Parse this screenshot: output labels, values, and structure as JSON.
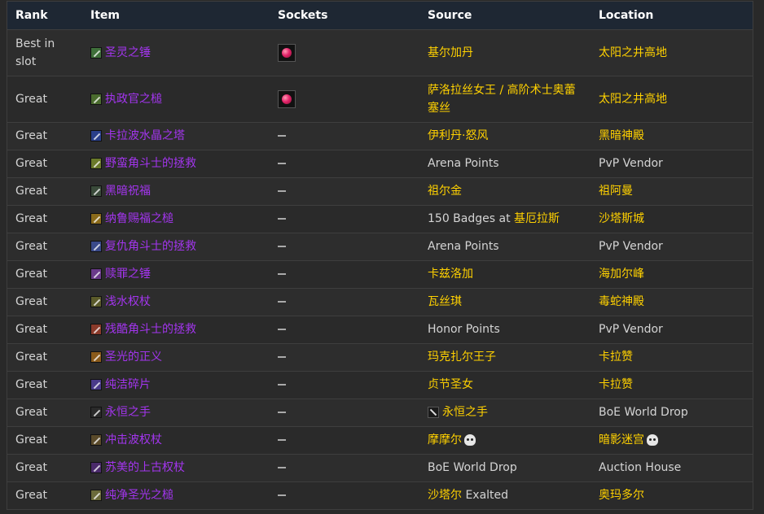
{
  "headers": {
    "rank": "Rank",
    "item": "Item",
    "sockets": "Sockets",
    "source": "Source",
    "location": "Location"
  },
  "rows": [
    {
      "rank": "Best in slot",
      "item": "圣灵之锤",
      "icon_color": "#3f6f3a",
      "socket": "red-gem",
      "source": [
        {
          "text": "基尔加丹",
          "style": "gold"
        }
      ],
      "location": [
        {
          "text": "太阳之井高地",
          "style": "gold"
        }
      ]
    },
    {
      "rank": "Great",
      "item": "执政官之槌",
      "icon_color": "#4a6b2e",
      "socket": "red-gem",
      "source": [
        {
          "text": "萨洛拉丝女王 / 高阶术士奥蕾塞丝",
          "style": "gold"
        }
      ],
      "location": [
        {
          "text": "太阳之井高地",
          "style": "gold"
        }
      ]
    },
    {
      "rank": "Great",
      "item": "卡拉波水晶之塔",
      "icon_color": "#2a3f8a",
      "socket": "none",
      "source": [
        {
          "text": "伊利丹·怒风",
          "style": "gold"
        }
      ],
      "location": [
        {
          "text": "黑暗神殿",
          "style": "gold"
        }
      ]
    },
    {
      "rank": "Great",
      "item": "野蛮角斗士的拯救",
      "icon_color": "#6a7a2a",
      "socket": "none",
      "source": [
        {
          "text": "Arena Points",
          "style": "plain"
        }
      ],
      "location": [
        {
          "text": "PvP Vendor",
          "style": "plain"
        }
      ]
    },
    {
      "rank": "Great",
      "item": "黑暗祝福",
      "icon_color": "#3a4a3a",
      "socket": "none",
      "source": [
        {
          "text": "祖尔金",
          "style": "gold"
        }
      ],
      "location": [
        {
          "text": "祖阿曼",
          "style": "gold"
        }
      ]
    },
    {
      "rank": "Great",
      "item": "纳鲁赐福之槌",
      "icon_color": "#8a6a1a",
      "socket": "none",
      "source": [
        {
          "text": "150 Badges at ",
          "style": "plain"
        },
        {
          "text": "基厄拉斯",
          "style": "gold"
        }
      ],
      "location": [
        {
          "text": "沙塔斯城",
          "style": "gold"
        }
      ]
    },
    {
      "rank": "Great",
      "item": "复仇角斗士的拯救",
      "icon_color": "#3a4a8a",
      "socket": "none",
      "source": [
        {
          "text": "Arena Points",
          "style": "plain"
        }
      ],
      "location": [
        {
          "text": "PvP Vendor",
          "style": "plain"
        }
      ]
    },
    {
      "rank": "Great",
      "item": "赎罪之锤",
      "icon_color": "#6a3a8a",
      "socket": "none",
      "source": [
        {
          "text": "卡兹洛加",
          "style": "gold"
        }
      ],
      "location": [
        {
          "text": "海加尔峰",
          "style": "gold"
        }
      ]
    },
    {
      "rank": "Great",
      "item": "浅水权杖",
      "icon_color": "#5a5a2a",
      "socket": "none",
      "source": [
        {
          "text": "瓦丝琪",
          "style": "gold"
        }
      ],
      "location": [
        {
          "text": "毒蛇神殿",
          "style": "gold"
        }
      ]
    },
    {
      "rank": "Great",
      "item": "残酷角斗士的拯救",
      "icon_color": "#8a3a2a",
      "socket": "none",
      "source": [
        {
          "text": "Honor Points",
          "style": "plain"
        }
      ],
      "location": [
        {
          "text": "PvP Vendor",
          "style": "plain"
        }
      ]
    },
    {
      "rank": "Great",
      "item": "圣光的正义",
      "icon_color": "#8a5a1a",
      "socket": "none",
      "source": [
        {
          "text": "玛克扎尔王子",
          "style": "gold"
        }
      ],
      "location": [
        {
          "text": "卡拉赞",
          "style": "gold"
        }
      ]
    },
    {
      "rank": "Great",
      "item": "纯洁碎片",
      "icon_color": "#4a3a8a",
      "socket": "none",
      "source": [
        {
          "text": "贞节圣女",
          "style": "gold"
        }
      ],
      "location": [
        {
          "text": "卡拉赞",
          "style": "gold"
        }
      ]
    },
    {
      "rank": "Great",
      "item": "永恒之手",
      "icon_color": "#2a2a2a",
      "socket": "none",
      "source": [
        {
          "text": "永恒之手",
          "style": "gold",
          "icon": true
        }
      ],
      "location": [
        {
          "text": "BoE World Drop",
          "style": "plain"
        }
      ]
    },
    {
      "rank": "Great",
      "item": "冲击波权杖",
      "icon_color": "#5a4a2a",
      "socket": "none",
      "source": [
        {
          "text": "摩摩尔",
          "style": "gold",
          "skull": true
        }
      ],
      "location": [
        {
          "text": "暗影迷宫",
          "style": "gold",
          "skull": true
        }
      ]
    },
    {
      "rank": "Great",
      "item": "苏美的上古权杖",
      "icon_color": "#4a2a6a",
      "socket": "none",
      "source": [
        {
          "text": "BoE World Drop",
          "style": "plain"
        }
      ],
      "location": [
        {
          "text": "Auction House",
          "style": "plain"
        }
      ]
    },
    {
      "rank": "Great",
      "item": "纯净圣光之槌",
      "icon_color": "#6a6a3a",
      "socket": "none",
      "source": [
        {
          "text": "沙塔尔 ",
          "style": "gold"
        },
        {
          "text": "Exalted",
          "style": "plain"
        }
      ],
      "location": [
        {
          "text": "奥玛多尔",
          "style": "gold"
        }
      ]
    }
  ]
}
